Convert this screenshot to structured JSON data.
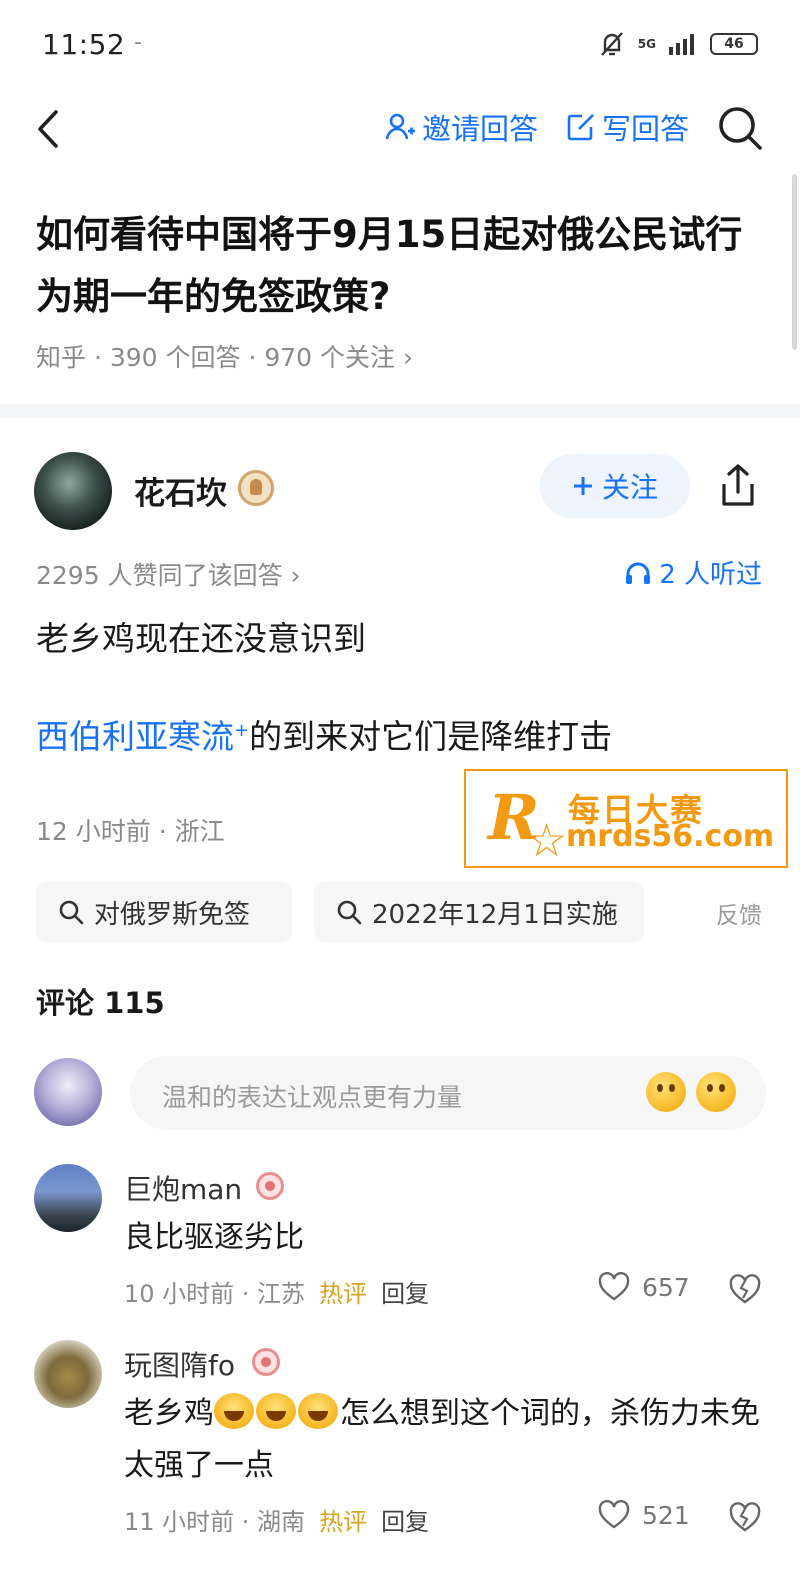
{
  "status": {
    "time": "11:52",
    "dash": "-",
    "network": "5G",
    "battery": "46"
  },
  "nav": {
    "invite_label": "邀请回答",
    "write_label": "写回答"
  },
  "question": {
    "title": "如何看待中国将于9月15日起对俄公民试行为期一年的免签政策?",
    "meta": "知乎 · 390 个回答 · 970 个关注 ›"
  },
  "answer": {
    "author": "花石坎",
    "follow_label": "关注",
    "likes_line": "2295 人赞同了该回答 ›",
    "listen_label": "2 人听过",
    "p1": "老乡鸡现在还没意识到",
    "p2_link": "西伯利亚寒流",
    "p2_plus": "+",
    "p2_rest": "的到来对它们是降维打击",
    "meta": "12 小时前 · 浙江"
  },
  "watermark": {
    "title": "每日大赛",
    "url": "mrds56.com",
    "logo_letter": "R"
  },
  "tags": [
    {
      "label": "对俄罗斯免签"
    },
    {
      "label": "2022年12月1日实施"
    }
  ],
  "feedback_label": "反馈",
  "comments": {
    "header": "评论 115",
    "input_placeholder": "温和的表达让观点更有力量",
    "items": [
      {
        "name": "巨炮man",
        "text": "良比驱逐劣比",
        "time": "10 小时前 · 江苏",
        "hot": "热评",
        "reply": "回复",
        "likes": "657"
      },
      {
        "name": "玩图隋fo",
        "text_before": "老乡鸡",
        "text_after": "怎么想到这个词的，杀伤力未免太强了一点",
        "time": "11 小时前 · 湖南",
        "hot": "热评",
        "reply": "回复",
        "likes": "521"
      }
    ]
  },
  "colors": {
    "accent": "#1772f6",
    "hot": "#d9a520",
    "watermark": "#f39a12"
  }
}
